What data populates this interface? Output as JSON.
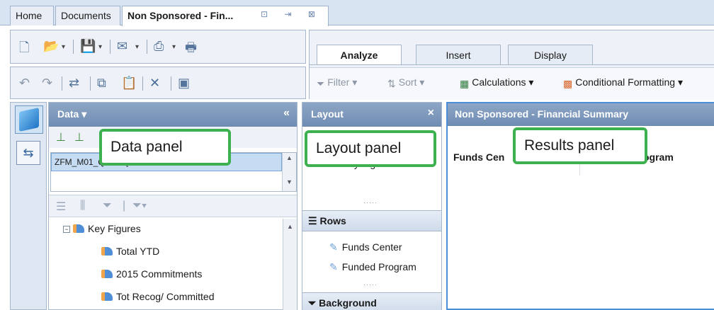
{
  "tabs": {
    "home": "Home",
    "documents": "Documents",
    "active": "Non Sponsored - Fin...",
    "active_icons": "⊡ ⇥ ⊠"
  },
  "ribbon": {
    "tabs": {
      "analyze": "Analyze",
      "insert": "Insert",
      "display": "Display"
    },
    "buttons": {
      "filter": "Filter",
      "sort": "Sort",
      "calculations": "Calculations",
      "conditional_formatting": "Conditional Formatting"
    }
  },
  "data_panel": {
    "title": "Data",
    "title_caret": "▾",
    "collapse": "«",
    "provider": "ZFM_M01_Q0004 [SAP Business Warehouse",
    "tree": {
      "root": "Key Figures",
      "items": [
        "Total YTD",
        "2015 Commitments",
        "Tot Recog/ Committed"
      ]
    }
  },
  "layout_panel": {
    "title": "Layout",
    "close": "×",
    "columns_item": "Key Figures",
    "rows_label": "Rows",
    "rows": [
      "Funds Center",
      "Funded Program"
    ],
    "background_label": "Background"
  },
  "results_panel": {
    "title": "Non Sponsored - Financial Summary",
    "col1": "Funds Cen",
    "col2": "ogram"
  },
  "callouts": {
    "data": "Data panel",
    "layout": "Layout panel",
    "results": "Results panel"
  }
}
